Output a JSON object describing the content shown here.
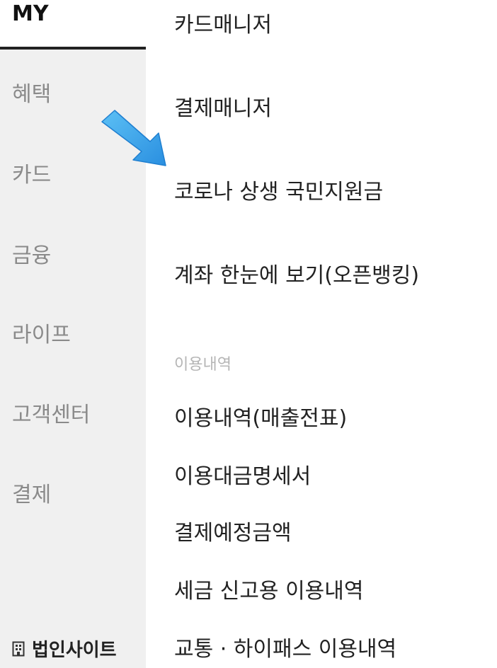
{
  "sidebar": {
    "active_tab": "MY",
    "items": [
      {
        "label": "혜택"
      },
      {
        "label": "카드"
      },
      {
        "label": "금융"
      },
      {
        "label": "라이프"
      },
      {
        "label": "고객센터"
      },
      {
        "label": "결제"
      }
    ],
    "corporate_link": "법인사이트"
  },
  "menu": {
    "items_top": [
      {
        "label": "카드매니저"
      },
      {
        "label": "결제매니저"
      },
      {
        "label": "코로나 상생 국민지원금"
      },
      {
        "label": "계좌 한눈에 보기(오픈뱅킹)"
      }
    ],
    "section_title": "이용내역",
    "section_items": [
      {
        "label": "이용내역(매출전표)"
      },
      {
        "label": "이용대금명세서"
      },
      {
        "label": "결제예정금액"
      },
      {
        "label": "세금 신고용 이용내역"
      },
      {
        "label": "교통 · 하이패스 이용내역"
      }
    ]
  },
  "colors": {
    "arrow": "#3ea8ec",
    "sidebar_bg": "#f0f0f0"
  }
}
